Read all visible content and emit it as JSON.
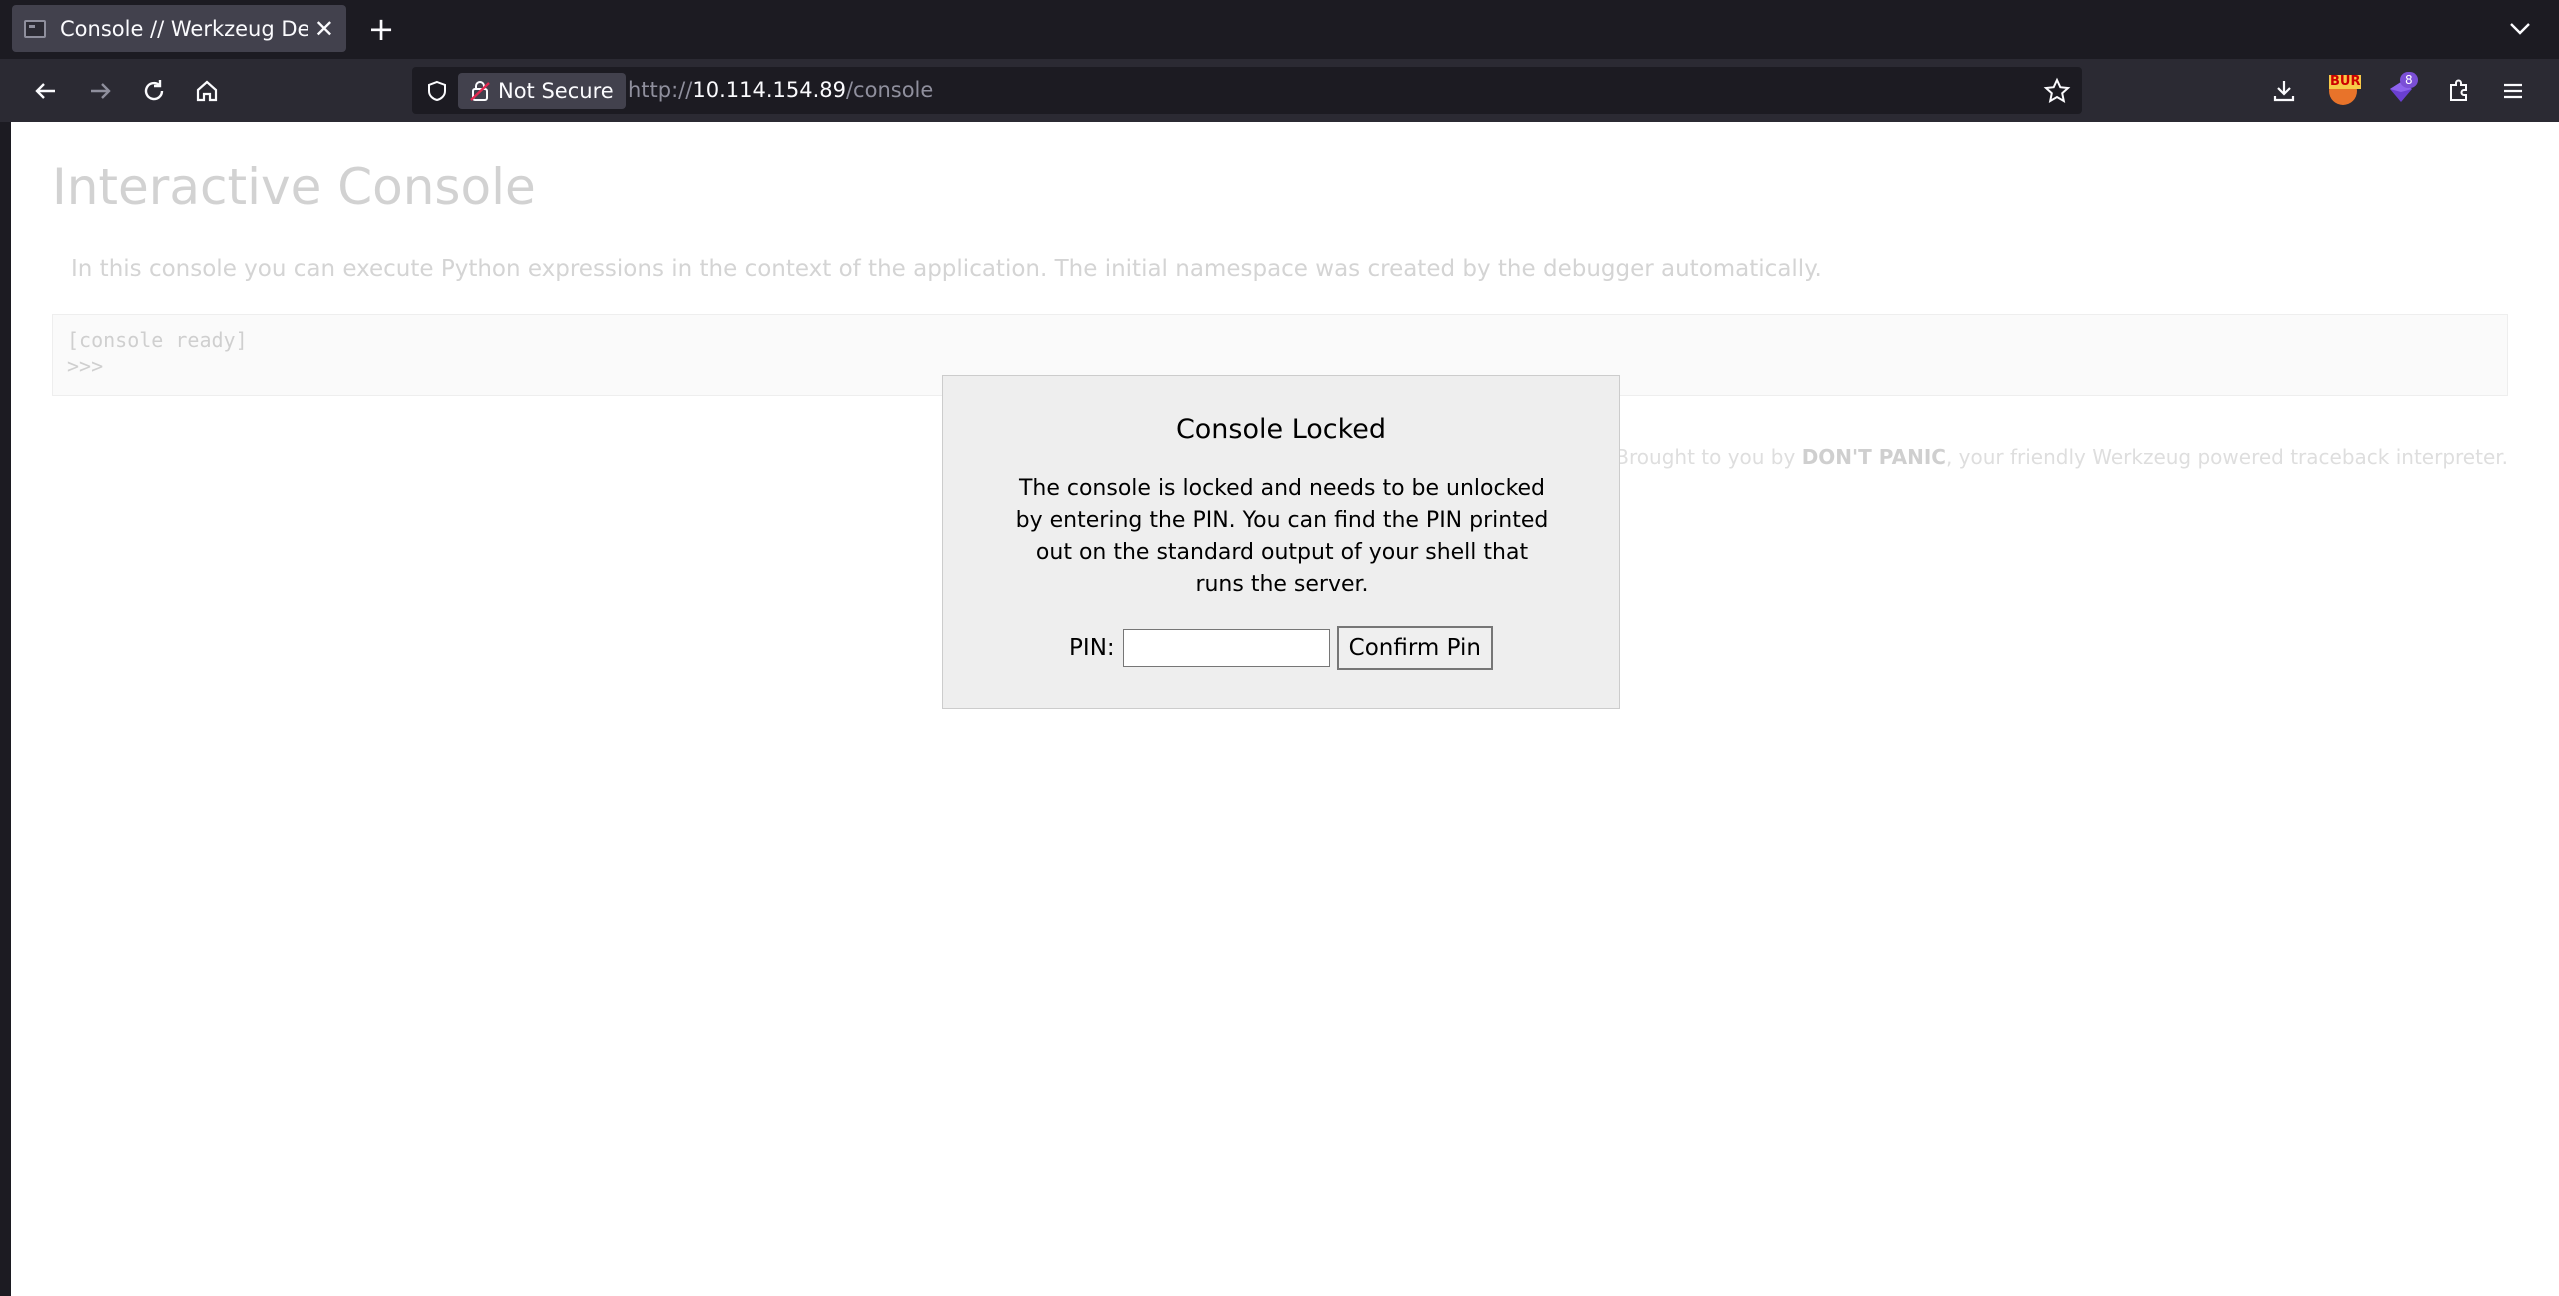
{
  "tab": {
    "title": "Console // Werkzeug Debugger",
    "close": "✕"
  },
  "newtab": "+",
  "urlbar": {
    "security_label": "Not Secure",
    "scheme": "http://",
    "host": "10.114.154.89",
    "path": "/console"
  },
  "extensions": {
    "burp_label": "BUR",
    "badge_count": "8"
  },
  "page": {
    "title": "Interactive Console",
    "intro": "In this console you can execute Python expressions in the context of the application. The initial namespace was created by the debugger automatically.",
    "console_line1": "[console ready]",
    "console_line2": ">>>",
    "footer_prefix": "Brought to you by ",
    "footer_bold": "DON'T PANIC",
    "footer_suffix": ", your friendly Werkzeug powered traceback interpreter."
  },
  "modal": {
    "title": "Console Locked",
    "description": "The console is locked and needs to be unlocked by entering the PIN. You can find the PIN printed out on the standard output of your shell that runs the server.",
    "pin_label": "PIN:",
    "pin_value": "",
    "confirm_label": "Confirm Pin"
  }
}
